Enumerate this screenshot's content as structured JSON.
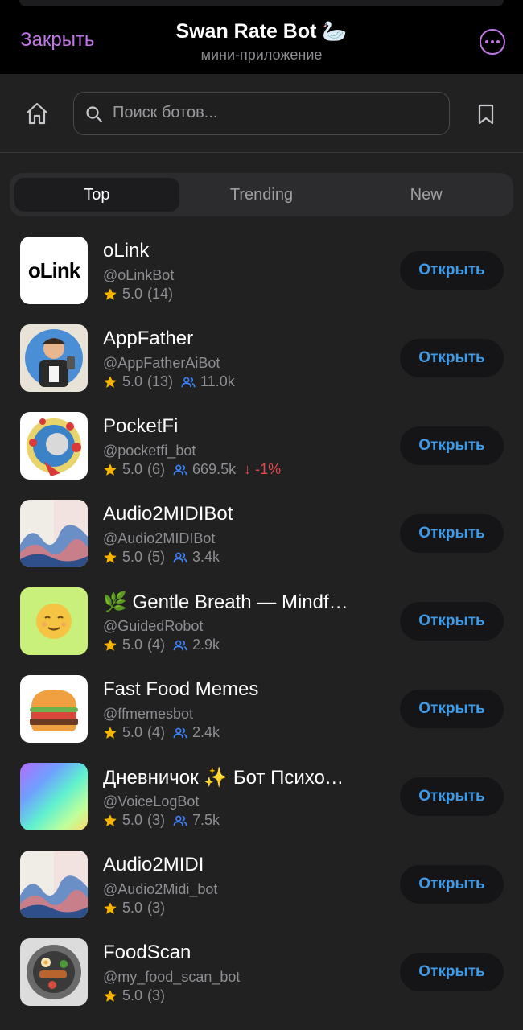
{
  "header": {
    "close_label": "Закрыть",
    "title": "Swan Rate Bot 🦢",
    "subtitle": "мини-приложение",
    "more_icon": "more-horizontal-icon"
  },
  "search": {
    "placeholder": "Поиск ботов...",
    "value": ""
  },
  "tabs": [
    {
      "label": "Top",
      "active": true
    },
    {
      "label": "Trending",
      "active": false
    },
    {
      "label": "New",
      "active": false
    }
  ],
  "open_label": "Открыть",
  "colors": {
    "accent_purple": "#c275e8",
    "button_blue": "#3d9be9",
    "star": "#f7b500",
    "users_icon": "#3b82f6",
    "trend_down": "#e5484d"
  },
  "bots": [
    {
      "name": "oLink",
      "handle": "@oLinkBot",
      "rating": "5.0",
      "reviews": "(14)",
      "users": "",
      "trend": "",
      "avatar": "olink-logo"
    },
    {
      "name": "AppFather",
      "handle": "@AppFatherAiBot",
      "rating": "5.0",
      "reviews": "(13)",
      "users": "11.0k",
      "trend": "",
      "avatar": "appfather-illustration"
    },
    {
      "name": "PocketFi",
      "handle": "@pocketfi_bot",
      "rating": "5.0",
      "reviews": "(6)",
      "users": "669.5k",
      "trend": "↓ -1%",
      "avatar": "pocketfi-logo"
    },
    {
      "name": "Audio2MIDIBot",
      "handle": "@Audio2MIDIBot",
      "rating": "5.0",
      "reviews": "(5)",
      "users": "3.4k",
      "trend": "",
      "avatar": "wave-art"
    },
    {
      "name": "🌿 Gentle Breath — Mindfulness",
      "handle": "@GuidedRobot",
      "rating": "5.0",
      "reviews": "(4)",
      "users": "2.9k",
      "trend": "",
      "avatar": "relieved-face"
    },
    {
      "name": "Fast Food Memes",
      "handle": "@ffmemesbot",
      "rating": "5.0",
      "reviews": "(4)",
      "users": "2.4k",
      "trend": "",
      "avatar": "burger"
    },
    {
      "name": "Дневничок ✨ Бот Психолог",
      "handle": "@VoiceLogBot",
      "rating": "5.0",
      "reviews": "(3)",
      "users": "7.5k",
      "trend": "",
      "avatar": "gradient"
    },
    {
      "name": "Audio2MIDI",
      "handle": "@Audio2Midi_bot",
      "rating": "5.0",
      "reviews": "(3)",
      "users": "",
      "trend": "",
      "avatar": "wave-art"
    },
    {
      "name": "FoodScan",
      "handle": "@my_food_scan_bot",
      "rating": "5.0",
      "reviews": "(3)",
      "users": "",
      "trend": "",
      "avatar": "food-plate"
    }
  ]
}
